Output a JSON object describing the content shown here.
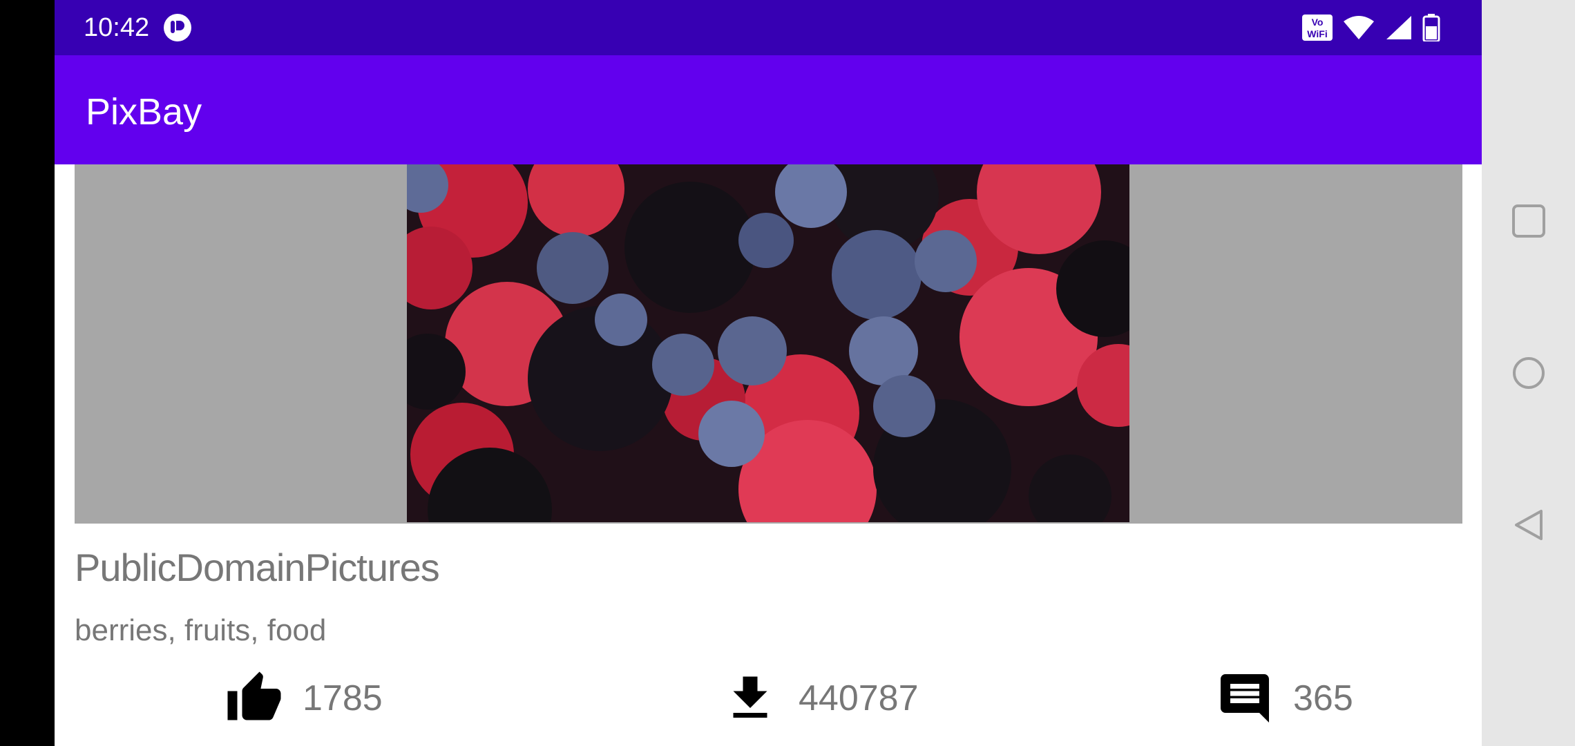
{
  "status_bar": {
    "time": "10:42",
    "app_icon": "pixabay-notification-icon",
    "wifi_calling_icon": "vowifi-icon",
    "wifi_icon": "wifi-icon",
    "signal_icon": "cell-signal-icon",
    "battery_icon": "battery-icon"
  },
  "app_bar": {
    "title": "PixBay"
  },
  "image_card": {
    "image_description_icon": "berries-photo",
    "author": "PublicDomainPictures",
    "tags": "berries, fruits, food",
    "likes": "1785",
    "downloads": "440787",
    "comments": "365",
    "likes_icon": "thumb-up-icon",
    "downloads_icon": "download-icon",
    "comments_icon": "comment-icon"
  },
  "nav_bar": {
    "recents_icon": "square-icon",
    "home_icon": "circle-icon",
    "back_icon": "triangle-back-icon"
  },
  "colors": {
    "status_bar": "#3700b3",
    "app_bar": "#6200ee",
    "image_frame": "#a7a7a7",
    "text_secondary": "#777777"
  }
}
